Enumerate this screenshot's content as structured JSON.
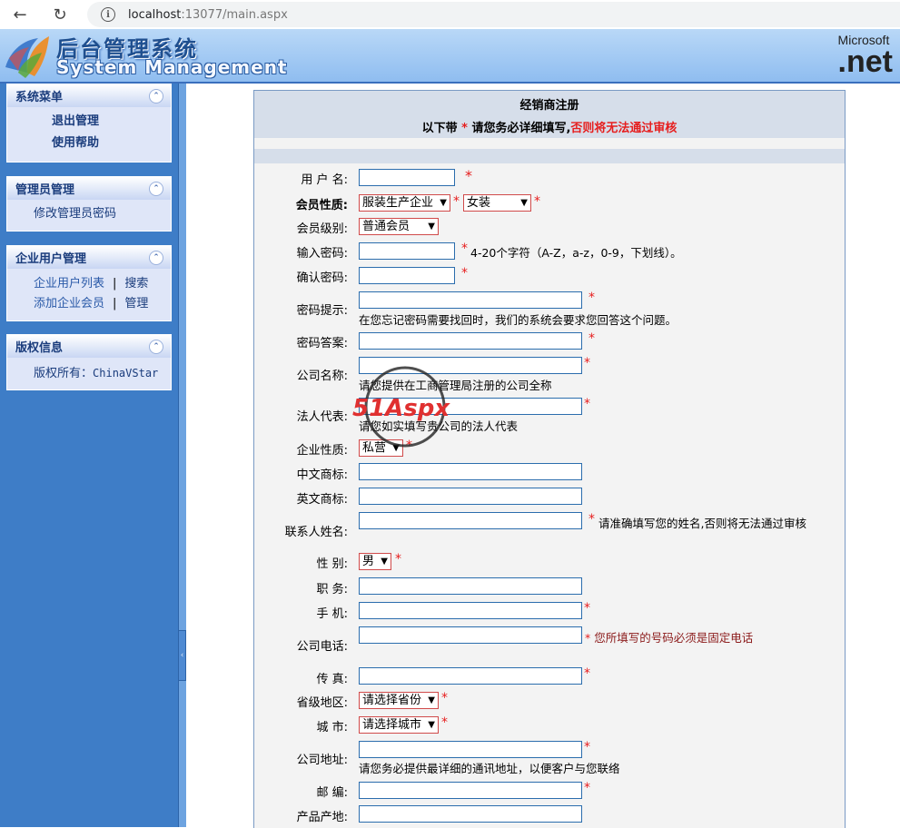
{
  "browser": {
    "url_host": "localhost",
    "url_rest": ":13077/main.aspx"
  },
  "banner": {
    "title_cn": "后台管理系统",
    "title_en": "System Management",
    "ms_text": "Microsoft",
    "net_text": ".net"
  },
  "sidebar": {
    "panels": [
      {
        "title": "系统菜单",
        "items": [
          "退出管理",
          "使用帮助"
        ]
      },
      {
        "title": "管理员管理",
        "items": [
          "修改管理员密码"
        ]
      },
      {
        "title": "企业用户管理",
        "rows": [
          [
            "企业用户列表",
            "|",
            "搜索"
          ],
          [
            "添加企业会员",
            "|",
            "管理"
          ]
        ]
      },
      {
        "title": "版权信息",
        "copyright_label": "版权所有：",
        "copyright_value": "ChinaVStar"
      }
    ]
  },
  "form": {
    "title": "经销商注册",
    "sub_prefix": "以下带",
    "sub_star": "*",
    "sub_middle": "请您务必详细填写,",
    "sub_warning": "否则将无法通过审核",
    "star": "*",
    "fields": {
      "username": {
        "label": "用 户 名:"
      },
      "member_type": {
        "label": "会员性质:",
        "value1": "服装生产企业",
        "value2": "女装"
      },
      "member_level": {
        "label": "会员级别:",
        "value": "普通会员"
      },
      "password": {
        "label": "输入密码:",
        "note": "4-20个字符（A-Z，a-z，0-9，下划线）。"
      },
      "confirm_password": {
        "label": "确认密码:"
      },
      "pwd_hint": {
        "label": "密码提示:",
        "note": "在您忘记密码需要找回时，我们的系统会要求您回答这个问题。"
      },
      "pwd_answer": {
        "label": "密码答案:"
      },
      "company_name": {
        "label": "公司名称:",
        "note": "请您提供在工商管理局注册的公司全称"
      },
      "legal_rep": {
        "label": "法人代表:",
        "note": "请您如实填写贵公司的法人代表"
      },
      "company_type": {
        "label": "企业性质:",
        "value": "私营"
      },
      "cn_brand": {
        "label": "中文商标:"
      },
      "en_brand": {
        "label": "英文商标:"
      },
      "contact_name": {
        "label": "联系人姓名:",
        "note": "请准确填写您的姓名,否则将无法通过审核"
      },
      "gender": {
        "label": "性 别:",
        "value": "男"
      },
      "position": {
        "label": "职 务:"
      },
      "mobile": {
        "label": "手 机:"
      },
      "phone": {
        "label": "公司电话:",
        "note": "您所填写的号码必须是固定电话"
      },
      "fax": {
        "label": "传 真:"
      },
      "province": {
        "label": "省级地区:",
        "value": "请选择省份"
      },
      "city": {
        "label": "城 市:",
        "value": "请选择城市"
      },
      "address": {
        "label": "公司地址:",
        "note": "请您务必提供最详细的通讯地址，以便客户与您联络"
      },
      "postcode": {
        "label": "邮 编:"
      },
      "origin": {
        "label": "产品产地:"
      }
    }
  },
  "watermark": {
    "text": "51Aspx"
  }
}
